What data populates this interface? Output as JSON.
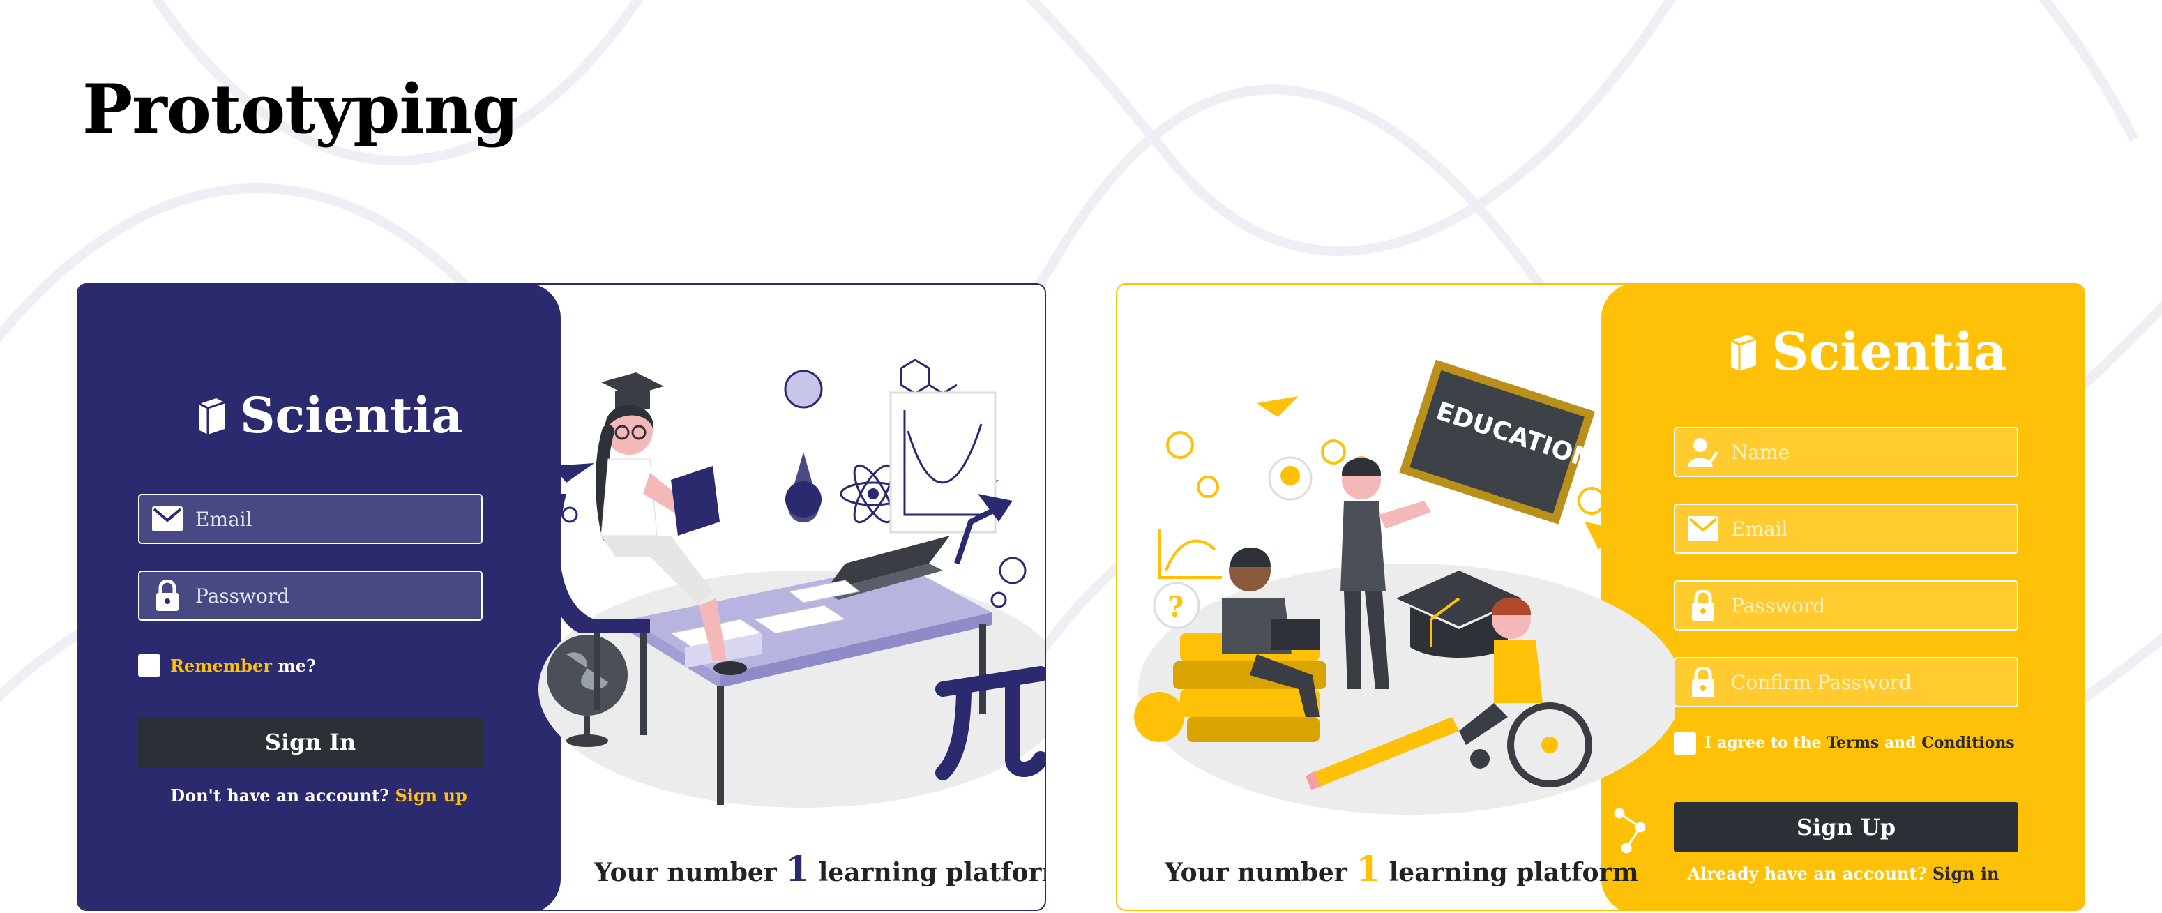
{
  "page": {
    "title": "Prototyping"
  },
  "colors": {
    "indigo": "#2b2a6e",
    "yellow": "#ffc107",
    "button": "#2b2f36",
    "white": "#ffffff"
  },
  "signin_card": {
    "logo_text": "Scientia",
    "logo_icon": "book-icon",
    "email_placeholder": "Email",
    "email_icon": "envelope-icon",
    "password_placeholder": "Password",
    "password_icon": "lock-icon",
    "remember_highlight": "Remember",
    "remember_rest": " me?",
    "button_label": "Sign In",
    "account_prompt": "Don't have an account? ",
    "account_link": "Sign up",
    "tagline_before": "Your number ",
    "tagline_number": "1",
    "tagline_after": " learning platform",
    "illustration": "student-studying-at-desk"
  },
  "signup_card": {
    "logo_text": "Scientia",
    "logo_icon": "book-icon",
    "name_placeholder": "Name",
    "name_icon": "user-icon",
    "email_placeholder": "Email",
    "email_icon": "envelope-icon",
    "password_placeholder": "Password",
    "password_icon": "lock-icon",
    "confirm_placeholder": "Confirm Password",
    "confirm_icon": "lock-icon",
    "agree_prefix": "I agree to the ",
    "terms": "Terms",
    "and_word": " and ",
    "conditions": "Conditions",
    "button_label": "Sign Up",
    "account_prompt": "Already have an account? ",
    "account_link": "Sign in",
    "tagline_before": "Your number ",
    "tagline_number": "1",
    "tagline_after": " learning platform",
    "blackboard_text": "EDUCATION",
    "illustration": "students-with-teacher-and-blackboard"
  }
}
